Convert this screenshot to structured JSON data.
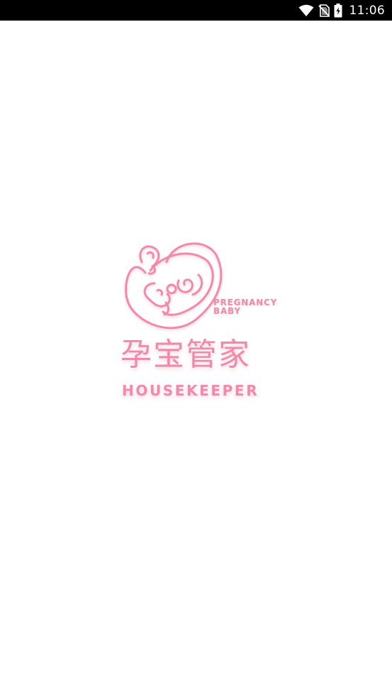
{
  "status_bar": {
    "time": "11:06",
    "icons": [
      "wifi-icon",
      "no-sim-icon",
      "battery-charging-icon"
    ]
  },
  "splash": {
    "logo": {
      "icon": "heart-mother-baby-logo-icon",
      "tagline_line1": "PREGNANCY",
      "tagline_line2": "BABY",
      "title_cn": "孕宝管家",
      "title_en": "HOUSEKEEPER"
    }
  },
  "colors": {
    "brand_pink": "#f389a8",
    "status_bar_bg": "#000000",
    "background": "#ffffff"
  }
}
